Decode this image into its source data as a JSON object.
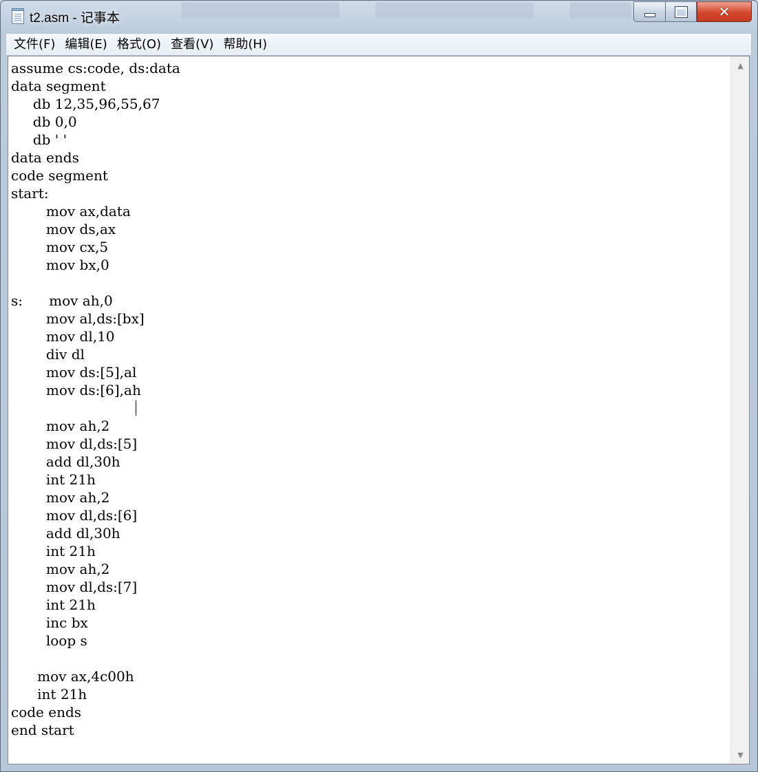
{
  "window": {
    "title": "t2.asm - 记事本",
    "close_glyph": "✕"
  },
  "menu": [
    "文件(F)",
    "编辑(E)",
    "格式(O)",
    "查看(V)",
    "帮助(H)"
  ],
  "editor": {
    "lines": [
      "assume cs:code, ds:data",
      "data segment",
      "     db 12,35,96,55,67",
      "     db 0,0",
      "     db ' '",
      "data ends",
      "code segment",
      "start:",
      "        mov ax,data",
      "        mov ds,ax",
      "        mov cx,5",
      "        mov bx,0",
      "",
      "s:      mov ah,0",
      "        mov al,ds:[bx]",
      "        mov dl,10",
      "        div dl",
      "        mov ds:[5],al",
      "        mov ds:[6],ah",
      "",
      "        mov ah,2",
      "        mov dl,ds:[5]",
      "        add dl,30h",
      "        int 21h",
      "        mov ah,2",
      "        mov dl,ds:[6]",
      "        add dl,30h",
      "        int 21h",
      "        mov ah,2",
      "        mov dl,ds:[7]",
      "        int 21h",
      "        inc bx",
      "        loop s",
      "",
      "      mov ax,4c00h",
      "      int 21h",
      "code ends",
      "end start"
    ]
  },
  "scrollbar": {
    "up_glyph": "▲",
    "down_glyph": "▼"
  }
}
